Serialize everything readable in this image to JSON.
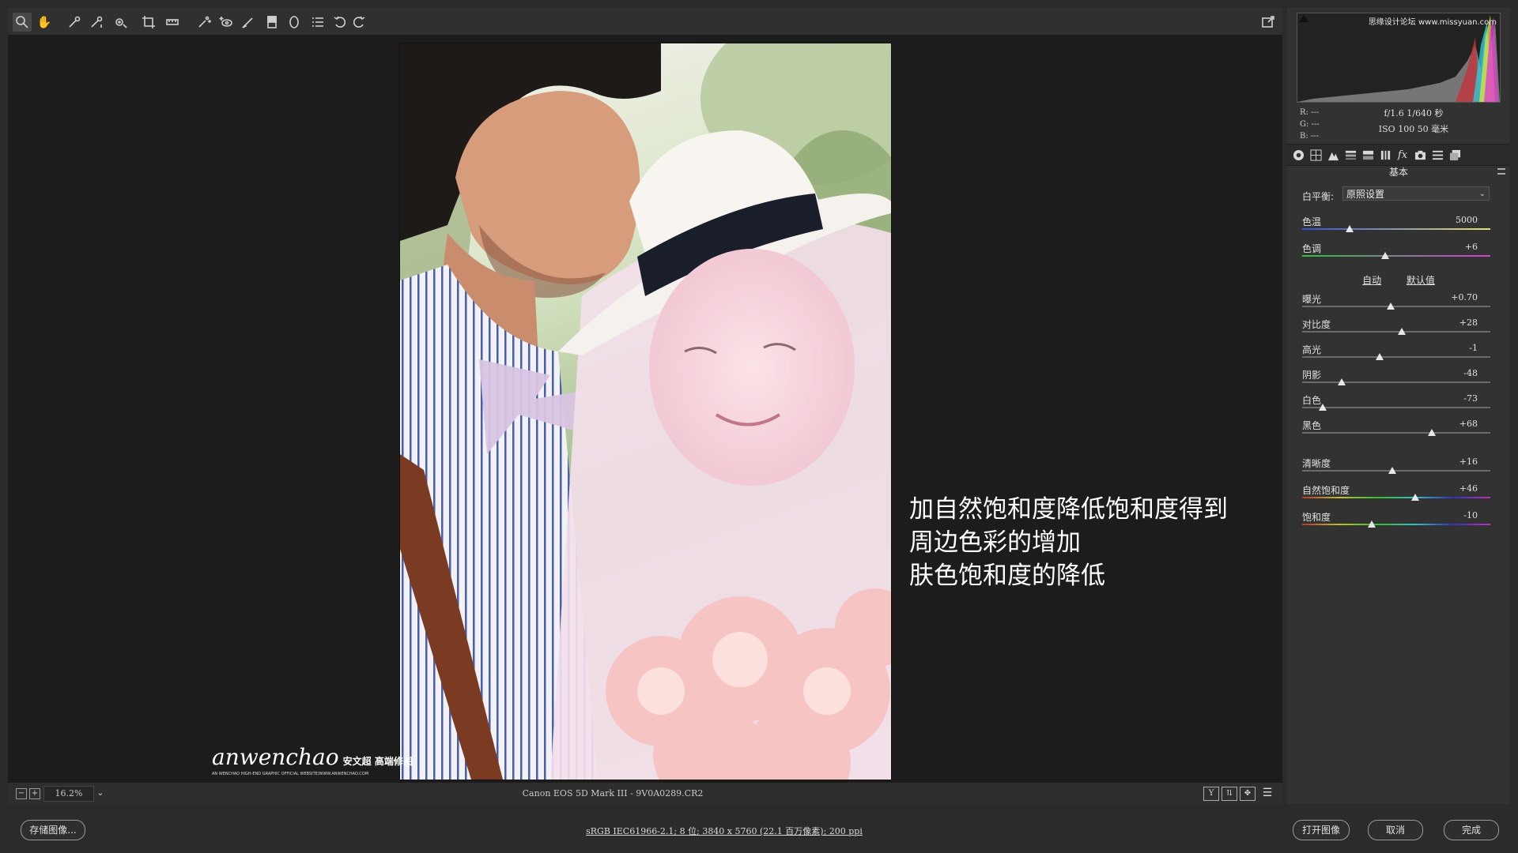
{
  "colors": {
    "app_bg": "#2b2b2b",
    "preview_bg": "#1c1c1c",
    "panel_bg": "#323232",
    "text": "#d6d6d6"
  },
  "toolbar": {
    "tools": [
      "zoom-icon",
      "hand-icon",
      "white-balance-icon",
      "color-sampler-icon",
      "targeted-adjustment-icon",
      "crop-icon",
      "straighten-icon",
      "spot-removal-icon",
      "red-eye-icon",
      "adjustment-brush-icon",
      "graduated-filter-icon",
      "radial-filter-icon",
      "preferences-icon",
      "rotate-left-icon",
      "rotate-right-icon"
    ],
    "fullscreen_icon": "fullscreen-icon"
  },
  "overlay": {
    "lines": [
      "加自然饱和度降低饱和度得到",
      "周边色彩的增加",
      "肤色饱和度的降低"
    ]
  },
  "photo": {
    "watermark_script": "anwenchao",
    "watermark_cn": "安文超 高端修图",
    "watermark_small": "AN WENCHAO HIGH-END GRAPHIC OFFICIAL WEBSITE/WWW.ANWENCHAO.COM"
  },
  "status": {
    "zoom_minus": "−",
    "zoom_plus": "+",
    "zoom_value": "16.2%",
    "zoom_dropdown": "⌄",
    "file_info": "Canon EOS 5D Mark III -  9V0A0289.CR2",
    "view_buttons": [
      "Y",
      "⇅",
      "✥",
      "☰"
    ]
  },
  "bottom": {
    "save_label": "存储图像...",
    "workflow": "sRGB IEC61966-2.1; 8 位; 3840 x 5760 (22.1 百万像素); 200 ppi",
    "open_label": "打开图像",
    "cancel_label": "取消",
    "done_label": "完成"
  },
  "histogram": {
    "watermark": "思缘设计论坛 www.missyuan.com",
    "r": "R:  ---",
    "g": "G:  ---",
    "b": "B:  ---",
    "exif_line1": "f/1.6  1/640 秒",
    "exif_line2": "ISO 100  50 毫米"
  },
  "panel": {
    "tabs": [
      "basic-icon",
      "tone-curve-icon",
      "detail-icon",
      "hsl-icon",
      "split-toning-icon",
      "lens-corrections-icon",
      "effects-icon",
      "camera-calibration-icon",
      "presets-icon",
      "snapshots-icon"
    ],
    "title": "基本",
    "wb_label": "白平衡:",
    "wb_value": "原照设置",
    "auto_label": "自动",
    "default_label": "默认值",
    "sliders": [
      {
        "label": "色温",
        "value": "5000",
        "pos": 0.25
      },
      {
        "label": "色调",
        "value": "+6",
        "pos": 0.44
      },
      {
        "label": "曝光",
        "value": "+0.70",
        "pos": 0.47
      },
      {
        "label": "对比度",
        "value": "+28",
        "pos": 0.53
      },
      {
        "label": "高光",
        "value": "-1",
        "pos": 0.41
      },
      {
        "label": "阴影",
        "value": "-48",
        "pos": 0.21
      },
      {
        "label": "白色",
        "value": "-73",
        "pos": 0.11
      },
      {
        "label": "黑色",
        "value": "+68",
        "pos": 0.69
      },
      {
        "label": "清晰度",
        "value": "+16",
        "pos": 0.48
      },
      {
        "label": "自然饱和度",
        "value": "+46",
        "pos": 0.6
      },
      {
        "label": "饱和度",
        "value": "-10",
        "pos": 0.37
      }
    ]
  }
}
